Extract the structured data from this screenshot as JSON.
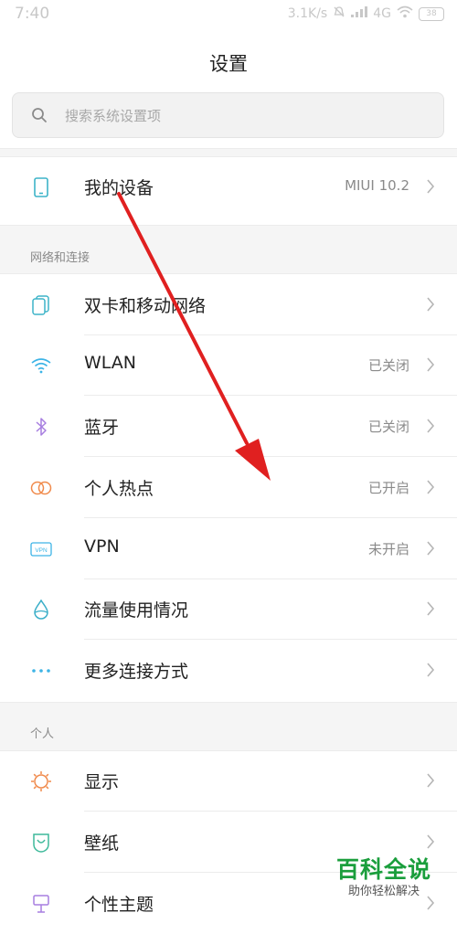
{
  "status_bar": {
    "time": "7:40",
    "net_speed": "3.1K/s",
    "network": "4G",
    "battery": "38"
  },
  "header": {
    "title": "设置"
  },
  "search": {
    "placeholder": "搜索系统设置项"
  },
  "device_row": {
    "label": "我的设备",
    "value": "MIUI 10.2"
  },
  "network_section": {
    "header": "网络和连接",
    "items": [
      {
        "label": "双卡和移动网络",
        "value": "",
        "icon": "dual-sim-icon"
      },
      {
        "label": "WLAN",
        "value": "已关闭",
        "icon": "wifi-icon"
      },
      {
        "label": "蓝牙",
        "value": "已关闭",
        "icon": "bluetooth-icon"
      },
      {
        "label": "个人热点",
        "value": "已开启",
        "icon": "hotspot-icon"
      },
      {
        "label": "VPN",
        "value": "未开启",
        "icon": "vpn-icon"
      },
      {
        "label": "流量使用情况",
        "value": "",
        "icon": "data-usage-icon"
      },
      {
        "label": "更多连接方式",
        "value": "",
        "icon": "more-connections-icon"
      }
    ]
  },
  "personal_section": {
    "header": "个人",
    "items": [
      {
        "label": "显示",
        "value": "",
        "icon": "display-icon"
      },
      {
        "label": "壁纸",
        "value": "",
        "icon": "wallpaper-icon"
      },
      {
        "label": "个性主题",
        "value": "",
        "icon": "theme-icon"
      }
    ]
  },
  "watermark": {
    "main": "百科全说",
    "sub": "助你轻松解决"
  },
  "colors": {
    "arrow": "#e02020",
    "watermark_green": "#1a9e3c",
    "device_icon": "#3db4c8",
    "wifi_icon": "#3db4e6",
    "bluetooth_icon": "#a77ee0",
    "hotspot_icon": "#f08a4b",
    "data_icon": "#3aaec8",
    "display_icon": "#f08a4b",
    "wallpaper_icon": "#3db99a",
    "theme_icon": "#a77ee0"
  }
}
